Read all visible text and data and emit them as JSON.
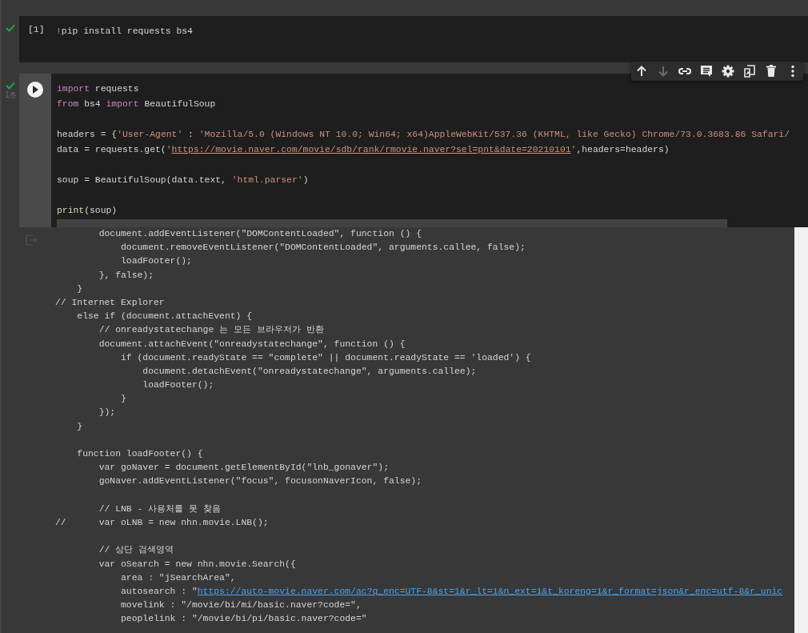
{
  "cells": [
    {
      "kind": "counter",
      "executed": true,
      "selected": false,
      "counter": "[1]",
      "blocks": [
        [
          [
            {
              "kind": "string",
              "t": "!"
            },
            {
              "kind": "plain",
              "t": "pip install requests bs4"
            }
          ]
        ]
      ]
    },
    {
      "kind": "run-button",
      "executed": true,
      "selected": true,
      "elapsed": "1초",
      "blocks": [
        [
          [
            {
              "kind": "keyword",
              "t": "import"
            },
            {
              "kind": "plain",
              "t": " requests"
            }
          ],
          [
            {
              "kind": "keyword",
              "t": "from"
            },
            {
              "kind": "plain",
              "t": " bs4 "
            },
            {
              "kind": "keyword",
              "t": "import"
            },
            {
              "kind": "plain",
              "t": " BeautifulSoup"
            }
          ]
        ],
        [
          [
            {
              "kind": "plain",
              "t": "headers = {"
            },
            {
              "kind": "string",
              "t": "'User-Agent'"
            },
            {
              "kind": "plain",
              "t": " : "
            },
            {
              "kind": "string",
              "t": "'Mozilla/5.0 (Windows NT 10.0; Win64; x64)AppleWebKit/537.36 (KHTML, like Gecko) Chrome/73.0.3683.86 Safari/"
            }
          ],
          [
            {
              "kind": "plain",
              "t": "data = requests.get("
            },
            {
              "kind": "string",
              "t": "'"
            },
            {
              "kind": "url",
              "t": "https://movie.naver.com/movie/sdb/rank/rmovie.naver?sel=pnt&date=20210101"
            },
            {
              "kind": "string",
              "t": "'"
            },
            {
              "kind": "plain",
              "t": ",headers=headers)"
            }
          ]
        ],
        [
          [
            {
              "kind": "plain",
              "t": "soup = BeautifulSoup(data.text, "
            },
            {
              "kind": "string",
              "t": "'html.parser'"
            },
            {
              "kind": "plain",
              "t": ")"
            }
          ]
        ],
        [
          [
            {
              "kind": "func",
              "t": "print"
            },
            {
              "kind": "plain",
              "t": "(soup)"
            }
          ]
        ]
      ],
      "output": [
        [
          [
            {
              "kind": "plain",
              "t": "        document.addEventListener(\"DOMContentLoaded\", function () {"
            }
          ],
          [
            {
              "kind": "plain",
              "t": "            document.removeEventListener(\"DOMContentLoaded\", arguments.callee, false);"
            }
          ],
          [
            {
              "kind": "plain",
              "t": "            loadFooter();"
            }
          ],
          [
            {
              "kind": "plain",
              "t": "        }, false);"
            }
          ],
          [
            {
              "kind": "plain",
              "t": "    }"
            }
          ],
          [
            {
              "kind": "plain",
              "t": "// Internet Explorer"
            }
          ],
          [
            {
              "kind": "plain",
              "t": "    else if (document.attachEvent) {"
            }
          ],
          [
            {
              "kind": "plain",
              "t": "        // onreadystatechange 는 모든 브라우저가 반환"
            }
          ],
          [
            {
              "kind": "plain",
              "t": "        document.attachEvent(\"onreadystatechange\", function () {"
            }
          ],
          [
            {
              "kind": "plain",
              "t": "            if (document.readyState == \"complete\" || document.readyState == 'loaded') {"
            }
          ],
          [
            {
              "kind": "plain",
              "t": "                document.detachEvent(\"onreadystatechange\", arguments.callee);"
            }
          ],
          [
            {
              "kind": "plain",
              "t": "                loadFooter();"
            }
          ],
          [
            {
              "kind": "plain",
              "t": "            }"
            }
          ],
          [
            {
              "kind": "plain",
              "t": "        });"
            }
          ],
          [
            {
              "kind": "plain",
              "t": "    }"
            }
          ]
        ],
        [
          [
            {
              "kind": "plain",
              "t": "    function loadFooter() {"
            }
          ],
          [
            {
              "kind": "plain",
              "t": "        var goNaver = document.getElementById(\"lnb_gonaver\");"
            }
          ],
          [
            {
              "kind": "plain",
              "t": "        goNaver.addEventListener(\"focus\", focusonNaverIcon, false);"
            }
          ]
        ],
        [
          [
            {
              "kind": "plain",
              "t": "        // LNB - 사용처를 못 찾음"
            }
          ],
          [
            {
              "kind": "plain",
              "t": "//      var oLNB = new nhn.movie.LNB();"
            }
          ]
        ],
        [
          [
            {
              "kind": "plain",
              "t": "        // 상단 검색영역"
            }
          ],
          [
            {
              "kind": "plain",
              "t": "        var oSearch = new nhn.movie.Search({"
            }
          ],
          [
            {
              "kind": "plain",
              "t": "            area : \"jSearchArea\","
            }
          ],
          [
            {
              "kind": "plain",
              "t": "            autosearch : \""
            },
            {
              "kind": "link",
              "t": "https://auto-movie.naver.com/ac?q_enc=UTF-8&st=1&r_lt=1&n_ext=1&t_koreng=1&r_format=json&r_enc=utf-8&r_unic"
            }
          ],
          [
            {
              "kind": "plain",
              "t": "            movelink : \"/movie/bi/mi/basic.naver?code=\","
            }
          ],
          [
            {
              "kind": "plain",
              "t": "            peoplelink : \"/movie/bi/pi/basic.naver?code=\""
            }
          ]
        ]
      ]
    }
  ],
  "toolbar": [
    {
      "kind": "move-up",
      "disabled": false
    },
    {
      "kind": "move-down",
      "disabled": true
    },
    {
      "kind": "link",
      "disabled": false
    },
    {
      "kind": "comment",
      "disabled": false
    },
    {
      "kind": "settings",
      "disabled": false
    },
    {
      "kind": "mirror",
      "disabled": false
    },
    {
      "kind": "delete",
      "disabled": false
    },
    {
      "kind": "more",
      "disabled": false
    }
  ]
}
